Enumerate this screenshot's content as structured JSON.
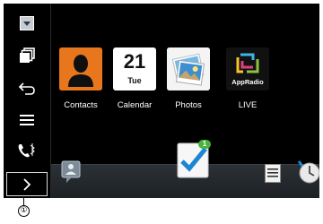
{
  "sidebar": {
    "items": [
      {
        "icon": "dropdown-icon"
      },
      {
        "icon": "pages-icon"
      },
      {
        "icon": "back-icon"
      },
      {
        "icon": "menu-icon"
      },
      {
        "icon": "phone-bluetooth-icon"
      }
    ],
    "next_icon": "chevron-right-icon"
  },
  "apps": [
    {
      "label": "Contacts",
      "icon": "contacts-icon",
      "color": "#e8761c"
    },
    {
      "label": "Calendar",
      "icon": "calendar-icon",
      "day": "21",
      "weekday": "Tue"
    },
    {
      "label": "Photos",
      "icon": "photos-icon"
    },
    {
      "label": "LIVE",
      "icon": "appradio-icon",
      "tile_text": "AppRadio"
    }
  ],
  "dock": {
    "center_badge": "1",
    "items": [
      {
        "icon": "voice-assistant-icon"
      },
      {
        "icon": "task-check-icon"
      },
      {
        "icon": "list-icon"
      },
      {
        "icon": "clock-icon"
      }
    ]
  },
  "callout": {
    "label": "①"
  }
}
